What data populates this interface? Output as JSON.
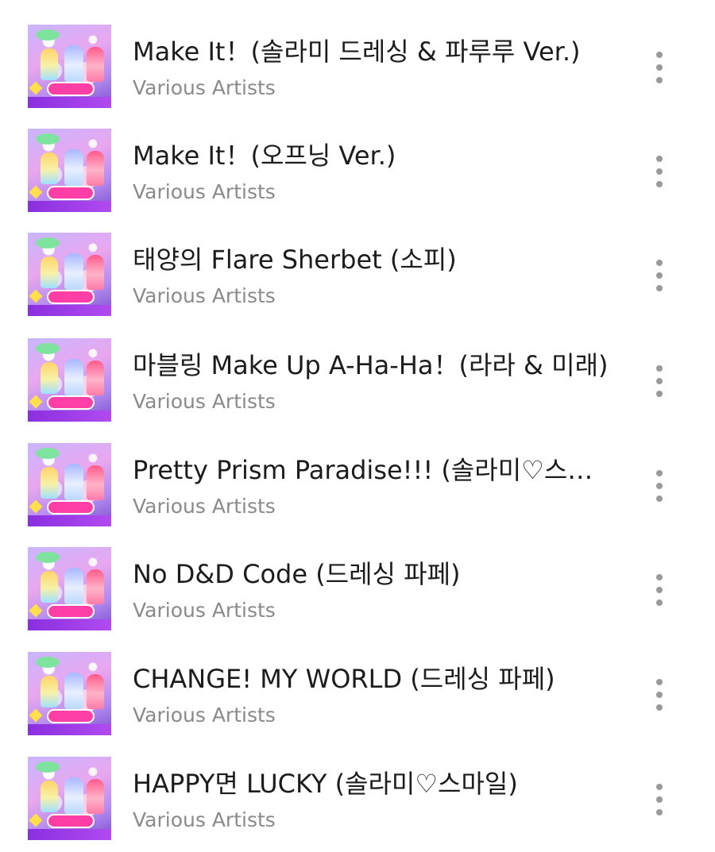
{
  "tracks": [
    {
      "title": "Make It！(솔라미 드레싱 & 파루루 Ver.)",
      "artist": "Various Artists",
      "menu_icon": "more-vertical-icon",
      "art_icon": "album-art-pripara"
    },
    {
      "title": "Make It！(오프닝 Ver.)",
      "artist": "Various Artists",
      "menu_icon": "more-vertical-icon",
      "art_icon": "album-art-pripara"
    },
    {
      "title": "태양의 Flare Sherbet (소피)",
      "artist": "Various Artists",
      "menu_icon": "more-vertical-icon",
      "art_icon": "album-art-pripara"
    },
    {
      "title": "마블링 Make Up A-Ha-Ha！(라라 & 미래)",
      "artist": "Various Artists",
      "menu_icon": "more-vertical-icon",
      "art_icon": "album-art-pripara"
    },
    {
      "title": "Pretty Prism Paradise!!! (솔라미♡스마…",
      "artist": "Various Artists",
      "menu_icon": "more-vertical-icon",
      "art_icon": "album-art-pripara"
    },
    {
      "title": "No D&D Code (드레싱 파페)",
      "artist": "Various Artists",
      "menu_icon": "more-vertical-icon",
      "art_icon": "album-art-pripara"
    },
    {
      "title": "CHANGE! MY WORLD (드레싱 파페)",
      "artist": "Various Artists",
      "menu_icon": "more-vertical-icon",
      "art_icon": "album-art-pripara"
    },
    {
      "title": "HAPPY면 LUCKY (솔라미♡스마일)",
      "artist": "Various Artists",
      "menu_icon": "more-vertical-icon",
      "art_icon": "album-art-pripara"
    }
  ],
  "colors": {
    "title_text": "#1c1c1c",
    "artist_text": "#8a8a8a",
    "menu_icon": "#9a9a9a",
    "background": "#ffffff"
  }
}
